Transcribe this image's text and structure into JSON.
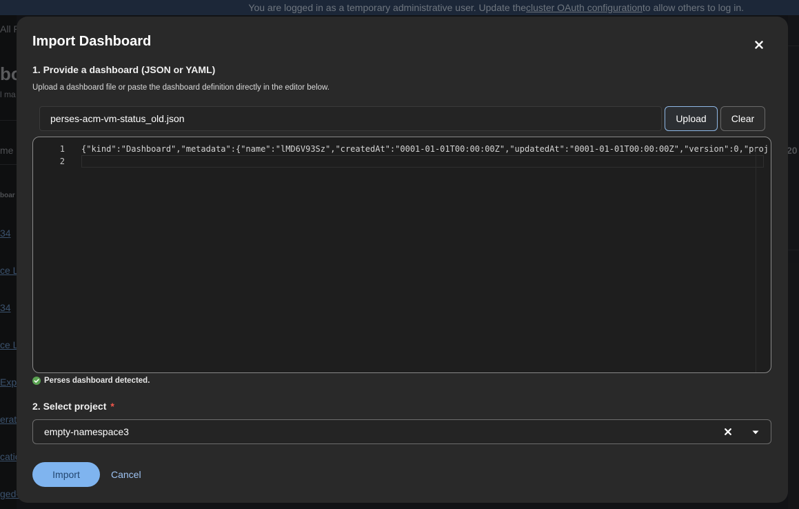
{
  "background": {
    "banner_text": "You are logged in as a temporary administrative user. Update the ",
    "banner_link": "cluster OAuth configuration",
    "banner_suffix": " to allow others to log in.",
    "fragments": [
      "All P",
      "bo",
      "l ma",
      "me",
      "boar",
      "34",
      "ce L",
      "34",
      "ce L",
      "Exp",
      "erat",
      "catio",
      "ged-",
      "20"
    ]
  },
  "modal": {
    "title": "Import Dashboard",
    "close_icon": "close-icon",
    "step1_title": "1. Provide a dashboard (JSON or YAML)",
    "step1_helper": "Upload a dashboard file or paste the dashboard definition directly in the editor below.",
    "file_name": "perses-acm-vm-status_old.json",
    "upload_label": "Upload",
    "clear_label": "Clear",
    "editor": {
      "line_numbers": [
        "1",
        "2"
      ],
      "lines": [
        "{\"kind\":\"Dashboard\",\"metadata\":{\"name\":\"lMD6V93Sz\",\"createdAt\":\"0001-01-01T00:00:00Z\",\"updatedAt\":\"0001-01-01T00:00:00Z\",\"version\":0,\"proj",
        ""
      ]
    },
    "status_icon": "check-circle-icon",
    "status_text": "Perses dashboard detected.",
    "step2_title": "2. Select project",
    "required_mark": "*",
    "project_value": "empty-namespace3",
    "import_label": "Import",
    "cancel_label": "Cancel"
  },
  "colors": {
    "accent": "#7fb4ef",
    "success": "#5ba352",
    "required": "#f0564b"
  }
}
